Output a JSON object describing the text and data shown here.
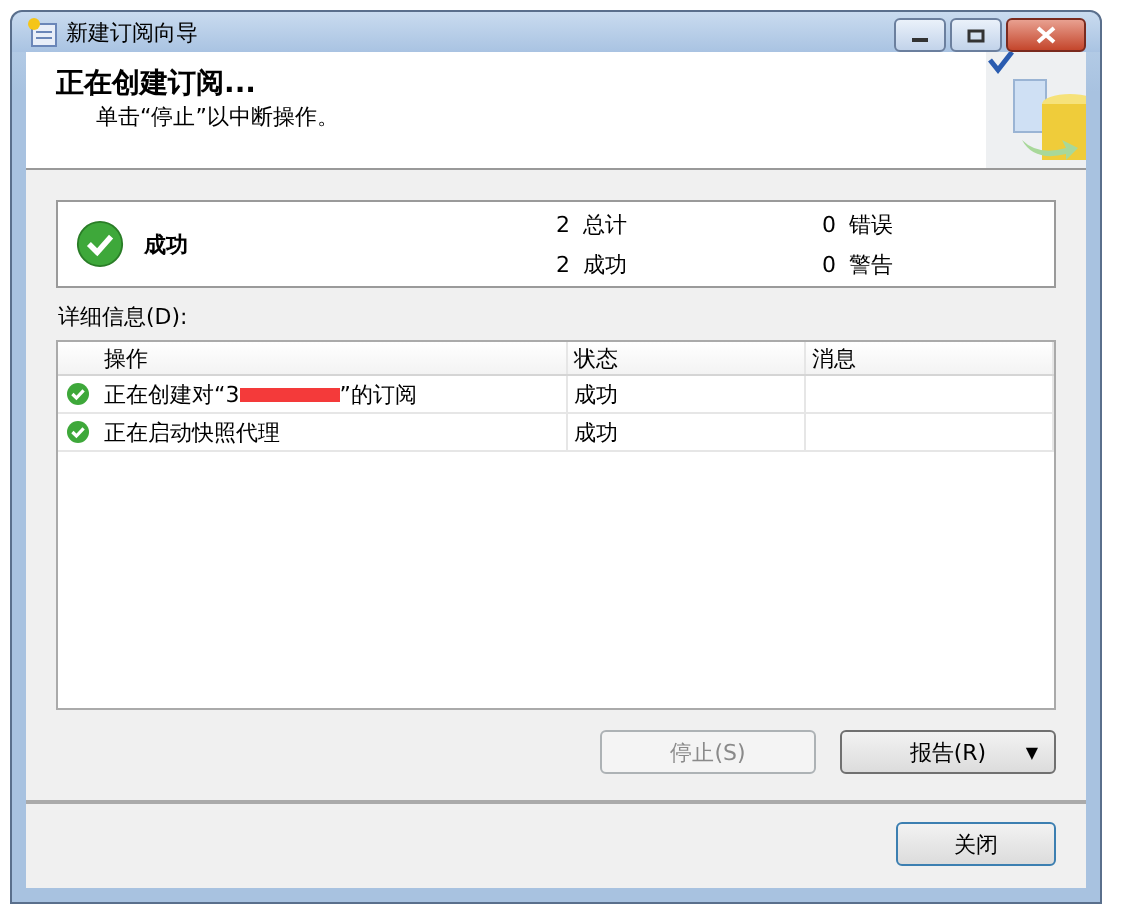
{
  "window": {
    "title": "新建订阅向导"
  },
  "header": {
    "title": "正在创建订阅...",
    "subtitle": "单击“停止”以中断操作。"
  },
  "summary": {
    "status": "成功",
    "success": true,
    "counts": [
      "2 总计",
      "2 成功",
      "0 错误",
      "0 警告"
    ]
  },
  "details": {
    "label": "详细信息(D):",
    "columns": [
      "操作",
      "状态",
      "消息"
    ],
    "rows": [
      {
        "action_before": "正在创建对“3",
        "redacted": true,
        "action_after": "”的订阅",
        "status": "成功",
        "success": true
      },
      {
        "action_before": "正在启动快照代理",
        "redacted": false,
        "action_after": "",
        "status": "成功",
        "success": true
      }
    ]
  },
  "buttons": {
    "stop": {
      "label": "停止(S)",
      "disabled": true
    },
    "report": {
      "label": "报告(R)",
      "caret": "▼"
    },
    "close": {
      "label": "关闭"
    }
  }
}
